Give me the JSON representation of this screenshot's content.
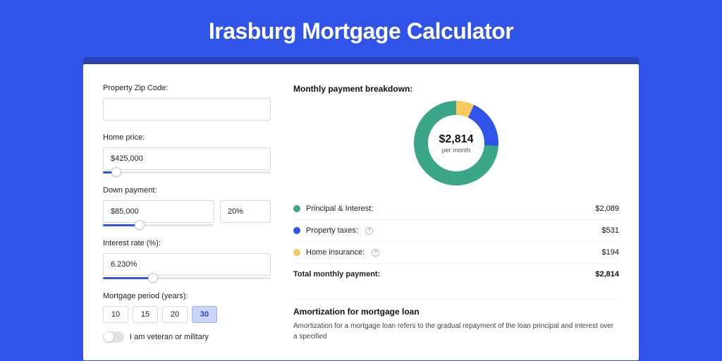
{
  "hero": {
    "title": "Irasburg Mortgage Calculator"
  },
  "form": {
    "zip": {
      "label": "Property Zip Code:",
      "value": ""
    },
    "price": {
      "label": "Home price:",
      "value": "$425,000",
      "sliderPct": 8
    },
    "down": {
      "label": "Down payment:",
      "value": "$85,000",
      "pct": "20%",
      "sliderPct": 22
    },
    "rate": {
      "label": "Interest rate (%):",
      "value": "6.230%",
      "sliderPct": 30
    },
    "period": {
      "label": "Mortgage period (years):",
      "options": [
        "10",
        "15",
        "20",
        "30"
      ],
      "active": "30"
    },
    "veteran": {
      "label": "I am veteran or military",
      "on": false
    }
  },
  "breakdown": {
    "title": "Monthly payment breakdown:",
    "center_value": "$2,814",
    "center_sub": "per month",
    "items": [
      {
        "label": "Principal & Interest:",
        "value": "$2,089",
        "color": "#3aa587",
        "info": false,
        "share": 74
      },
      {
        "label": "Property taxes:",
        "value": "$531",
        "color": "#3054e8",
        "info": true,
        "share": 19
      },
      {
        "label": "Home insurance:",
        "value": "$194",
        "color": "#f4c95d",
        "info": true,
        "share": 7
      }
    ],
    "total": {
      "label": "Total monthly payment:",
      "value": "$2,814"
    }
  },
  "amort": {
    "title": "Amortization for mortgage loan",
    "text": "Amortization for a mortgage loan refers to the gradual repayment of the loan principal and interest over a specified"
  },
  "chart_data": {
    "type": "pie",
    "title": "Monthly payment breakdown",
    "series": [
      {
        "name": "Principal & Interest",
        "value": 2089,
        "color": "#3aa587"
      },
      {
        "name": "Property taxes",
        "value": 531,
        "color": "#3054e8"
      },
      {
        "name": "Home insurance",
        "value": 194,
        "color": "#f4c95d"
      }
    ],
    "total": 2814,
    "center_label": "$2,814 per month"
  }
}
